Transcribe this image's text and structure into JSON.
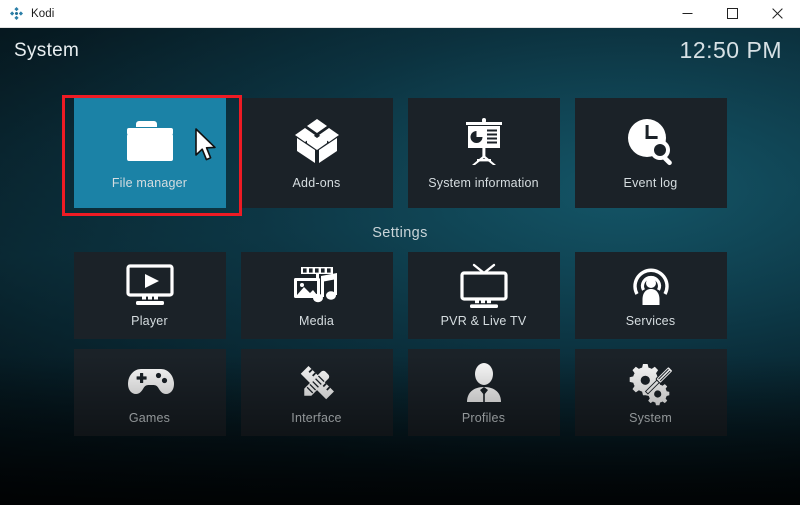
{
  "titlebar": {
    "app_name": "Kodi",
    "logo_icon": "kodi-logo-icon",
    "minimize_icon": "minimize-icon",
    "maximize_icon": "maximize-icon",
    "close_icon": "close-icon"
  },
  "header": {
    "page_title": "System",
    "clock": "12:50 PM"
  },
  "sections": {
    "settings_label": "Settings"
  },
  "colors": {
    "selected_tile": "#1b82a6",
    "tile_background": "#1b2228",
    "annotation_border": "#ee1b24",
    "title_text": "#e8eef0"
  },
  "top_row": [
    {
      "label": "File manager",
      "icon": "folder-icon",
      "selected": true
    },
    {
      "label": "Add-ons",
      "icon": "open-box-icon",
      "selected": false
    },
    {
      "label": "System information",
      "icon": "presentation-chart-icon",
      "selected": false
    },
    {
      "label": "Event log",
      "icon": "clock-search-icon",
      "selected": false
    }
  ],
  "settings_rows": [
    [
      {
        "label": "Player",
        "icon": "monitor-play-icon"
      },
      {
        "label": "Media",
        "icon": "film-photo-music-icon"
      },
      {
        "label": "PVR & Live TV",
        "icon": "tv-antenna-icon"
      },
      {
        "label": "Services",
        "icon": "broadcast-person-icon"
      }
    ],
    [
      {
        "label": "Games",
        "icon": "gamepad-icon"
      },
      {
        "label": "Interface",
        "icon": "pencil-ruler-icon"
      },
      {
        "label": "Profiles",
        "icon": "person-icon"
      },
      {
        "label": "System",
        "icon": "gears-screwdriver-icon"
      }
    ]
  ],
  "annotation": {
    "target": "File manager"
  },
  "cursor": {
    "icon": "mouse-pointer-icon"
  }
}
